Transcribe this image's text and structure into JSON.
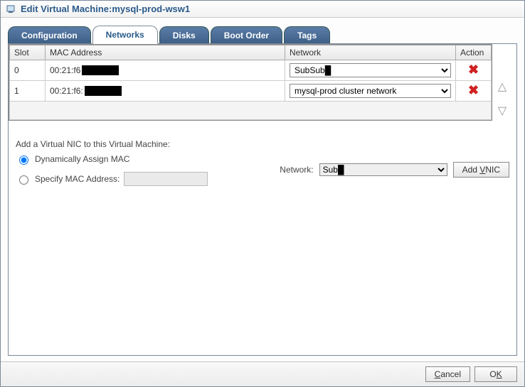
{
  "window": {
    "title": "Edit Virtual Machine:mysql-prod-wsw1"
  },
  "tabs": {
    "configuration": "Configuration",
    "networks": "Networks",
    "disks": "Disks",
    "boot_order": "Boot Order",
    "tags": "Tags"
  },
  "table": {
    "headers": {
      "slot": "Slot",
      "mac": "MAC Address",
      "network": "Network",
      "action": "Action"
    },
    "rows": [
      {
        "slot": "0",
        "mac_prefix": "00:21:f6",
        "network_selected": "Sub",
        "network_options": [
          "Sub",
          "mysql-prod cluster network"
        ]
      },
      {
        "slot": "1",
        "mac_prefix": "00:21:f6:",
        "network_selected": "mysql-prod cluster network",
        "network_options": [
          "Sub",
          "mysql-prod cluster network"
        ]
      }
    ]
  },
  "add_nic": {
    "section_label": "Add a Virtual NIC to this Virtual Machine:",
    "radio_dynamic": "Dynamically Assign MAC",
    "radio_specify": "Specify MAC Address:",
    "network_label": "Network:",
    "network_selected": "Sub",
    "network_options": [
      "Sub",
      "mysql-prod cluster network"
    ],
    "add_button_prefix": "Add ",
    "add_button_u": "V",
    "add_button_suffix": "NIC"
  },
  "footer": {
    "cancel": "Cancel",
    "cancel_u": "C",
    "ok": "OK",
    "ok_u": "K"
  }
}
